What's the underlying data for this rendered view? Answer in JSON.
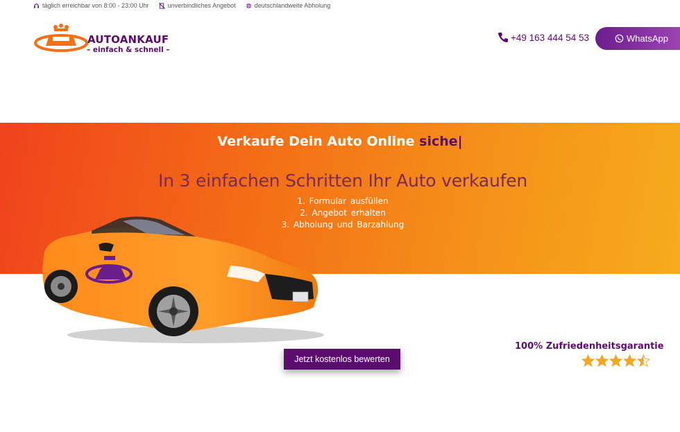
{
  "topbar": {
    "hours": "täglich erreichbar von 8:00 - 23:00 Uhr",
    "offer": "unverbindliches Angebot",
    "pickup": "deutschlandweite Abholung"
  },
  "logo": {
    "title": "AUTOANKAUF",
    "subtitle": "– einfach & schnell –"
  },
  "header": {
    "phone": "+49 163 444 54 53",
    "whatsapp_label": "WhatsApp"
  },
  "hero": {
    "headline": "Verkaufe Dein Auto Online",
    "typed_word": "siche|",
    "subheadline": "In 3 einfachen Schritten Ihr Auto verkaufen",
    "steps": [
      "1. Formular ausfüllen",
      "2. Angebot erhalten",
      "3. Abholung und Barzahlung"
    ]
  },
  "cta": {
    "label": "Jetzt kostenlos bewerten"
  },
  "guarantee": {
    "title": "100% Zufriedenheitsgarantie",
    "rating": 4.5,
    "max_rating": 5
  },
  "colors": {
    "brand_purple": "#5a0d6e",
    "brand_orange": "#f47016",
    "hero_start": "#f0421c",
    "hero_end": "#f6ab1c",
    "star": "#f5a623"
  },
  "icons": {
    "hours": "headset-icon",
    "offer": "no-commitment-icon",
    "pickup": "globe-icon",
    "phone": "phone-icon",
    "whatsapp": "whatsapp-icon"
  }
}
